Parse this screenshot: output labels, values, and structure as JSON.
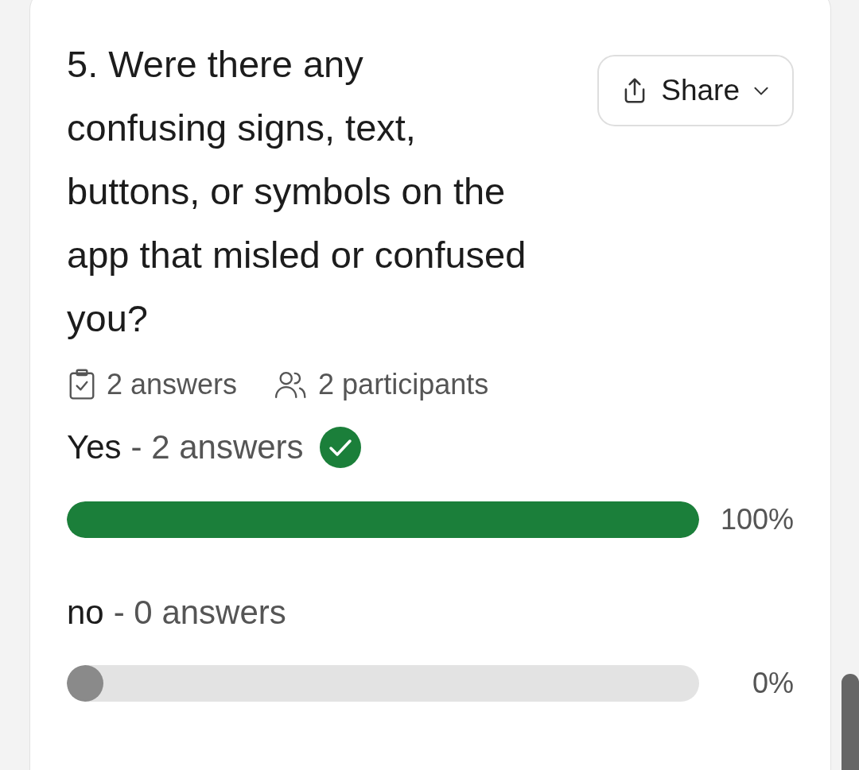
{
  "question": {
    "title": "5. Were there any confusing signs, text, buttons, or symbols on the app that misled or confused you?",
    "share_button": "Share",
    "answers_count": "2 answers",
    "participants_count": "2 participants"
  },
  "options": [
    {
      "label": "Yes",
      "count": "- 2 answers",
      "correct": true,
      "level": 1,
      "percent": "100%"
    },
    {
      "label": "no",
      "count": "- 0 answers",
      "correct": false,
      "level": 0,
      "percent": "0%"
    }
  ]
}
